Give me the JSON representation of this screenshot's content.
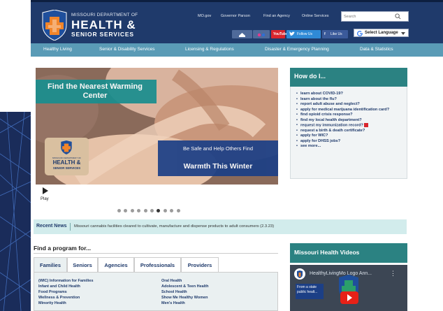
{
  "header": {
    "dept_line": "MISSOURI DEPARTMENT OF",
    "health_line": "HEALTH &",
    "senior_line": "SENIOR SERVICES",
    "top_links": [
      "MO.gov",
      "Governor Parson",
      "Find an Agency",
      "Online Services"
    ],
    "search_placeholder": "Search",
    "social": {
      "youtube": "YouTube",
      "twitter": "Follow Us",
      "facebook": "Like Us"
    },
    "translate_label": "Select Language",
    "colors": {
      "header_bg": "#1f3a6b",
      "nav_bg": "#5a9bb6",
      "accent_teal": "#2b8282"
    }
  },
  "nav": {
    "items": [
      "Healthy Living",
      "Senior & Disability Services",
      "Licensing & Regulations",
      "Disaster & Emergency Planning",
      "Data & Statistics"
    ]
  },
  "hero": {
    "title": "Find the Nearest Warming Center",
    "subtitle": "Be Safe and Help Others Find",
    "subtitle_bold": "Warmth This Winter",
    "logo_line1": "MISSOURI DEPARTMENT OF",
    "logo_line2": "HEALTH &",
    "logo_line3": "SENIOR SERVICES",
    "play_label": "Play",
    "slide_count": 10,
    "active_slide": 6
  },
  "howdoi": {
    "title": "How do I...",
    "items": [
      "learn about COVID-19?",
      "learn about the flu?",
      "report adult abuse and neglect?",
      "apply for medical marijuana identification card?",
      "find opioid crisis response?",
      "find my local health department?",
      "request my immunization record?",
      "request a birth & death certificate?",
      "apply for WIC?",
      "apply for DHSS jobs?",
      "see more..."
    ]
  },
  "news": {
    "label": "Recent News",
    "text": "Missouri cannabis facilities cleared to cultivate, manufacture and dispense products to adult consumers (2.3.23)"
  },
  "programs": {
    "heading": "Find a program for...",
    "tabs": [
      "Families",
      "Seniors",
      "Agencies",
      "Professionals",
      "Providers"
    ],
    "active_tab": "Families",
    "left_links": [
      "(WIC) Information for Families",
      "Infant and Child Health",
      "Food Programs",
      "Wellness & Prevention",
      "Minority Health"
    ],
    "right_links": [
      "Oral Health",
      "Adolescent & Teen Health",
      "School Health",
      "Show Me Healthy Women",
      "Men's Health"
    ]
  },
  "videos": {
    "heading": "Missouri Health Videos",
    "video_title": "HealthyLivingMo Logo Ann...",
    "overlay_text": "From a state public healt..."
  }
}
